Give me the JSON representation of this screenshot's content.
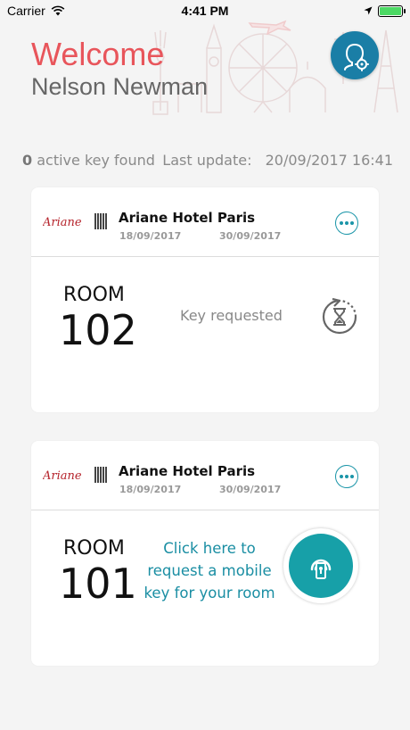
{
  "status_bar": {
    "carrier": "Carrier",
    "time": "4:41 PM"
  },
  "header": {
    "welcome": "Welcome",
    "user_name": "Nelson Newman"
  },
  "info": {
    "key_count": "0",
    "key_label": "active key found",
    "update_label": "Last update:",
    "update_time": "20/09/2017 16:41"
  },
  "bookings": [
    {
      "hotel_logo_text": "Ariane",
      "hotel_name": "Ariane Hotel Paris",
      "check_in": "18/09/2017",
      "check_out": "30/09/2017",
      "room_label": "ROOM",
      "room_number": "102",
      "status": "Key requested"
    },
    {
      "hotel_logo_text": "Ariane",
      "hotel_name": "Ariane Hotel Paris",
      "check_in": "18/09/2017",
      "check_out": "30/09/2017",
      "room_label": "ROOM",
      "room_number": "101",
      "request_text": "Click here to request a mobile key for your room"
    }
  ],
  "colors": {
    "accent_red": "#e8555b",
    "accent_teal": "#17a0a8",
    "profile_blue": "#1a7ea6",
    "battery_green": "#4cd964"
  }
}
